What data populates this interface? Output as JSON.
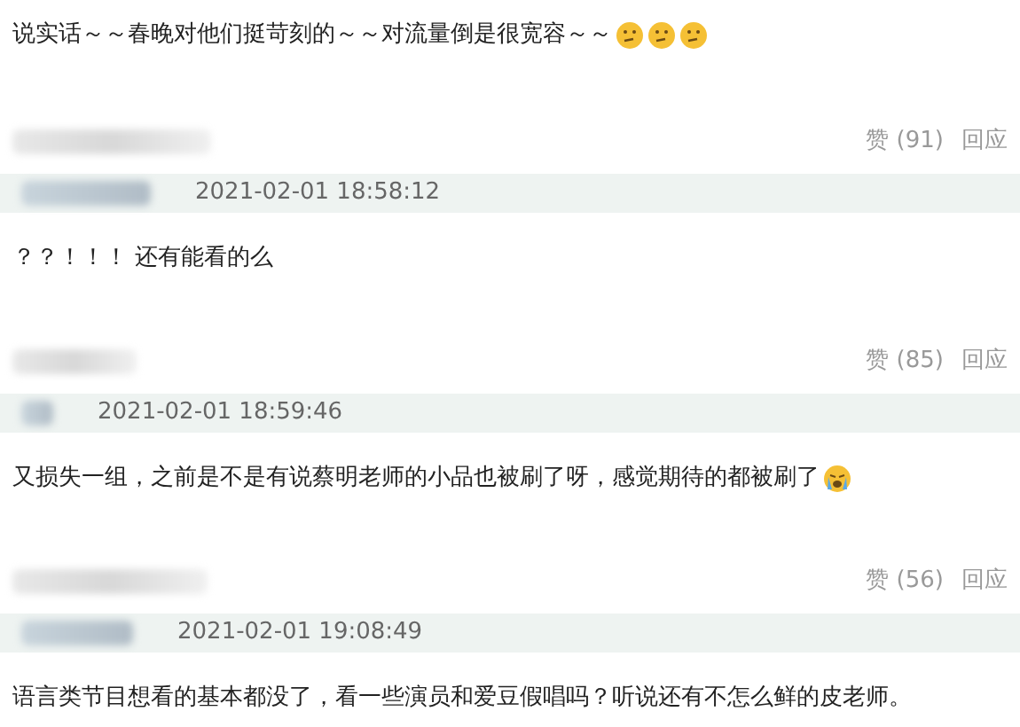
{
  "intro": {
    "text": "说实话～～春晚对他们挺苛刻的～～对流量倒是很宽容～～",
    "emojis": [
      {
        "kind": "thinking"
      },
      {
        "kind": "thinking"
      },
      {
        "kind": "thinking"
      }
    ]
  },
  "comments": [
    {
      "likes": "赞 (91)",
      "reply": "回应",
      "time": "2021-02-01 18:58:12",
      "text": "？？！！！ 还有能看的么"
    },
    {
      "likes": "赞 (85)",
      "reply": "回应",
      "time": "2021-02-01 18:59:46",
      "text": "又损失一组，之前是不是有说蔡明老师的小品也被刷了呀，感觉期待的都被刷了",
      "emojis": [
        {
          "kind": "crying"
        }
      ]
    },
    {
      "likes": "赞 (56)",
      "reply": "回应",
      "time": "2021-02-01 19:08:49",
      "text": "语言类节目想看的基本都没了，看一些演员和爱豆假唱吗？听说还有不怎么鲜的皮老师。"
    }
  ]
}
